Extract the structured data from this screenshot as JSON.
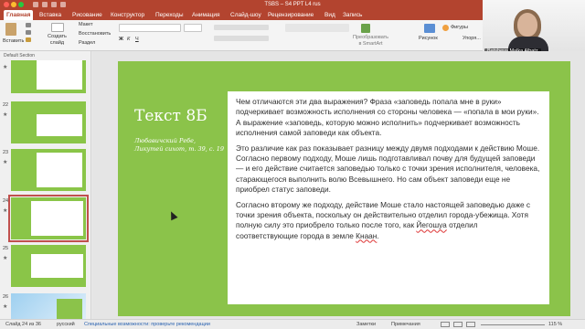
{
  "window": {
    "title": "TSBS – S4 PPT L4 rus"
  },
  "tabs": [
    "Главная",
    "Вставка",
    "Рисование",
    "Конструктор",
    "Переходы",
    "Анимация",
    "Слайд-шоу",
    "Рецензирование",
    "Вид",
    "Запись"
  ],
  "ribbon": {
    "paste": "Вставить",
    "new_slide": "Создать\nслайд",
    "layout": "Макет",
    "reset": "Восстановить",
    "section": "Раздел",
    "convert": "Преобразовать\nв SmartArt",
    "picture": "Рисунок",
    "shapes": "Фигуры",
    "arrange": "Упоря..."
  },
  "webcam": {
    "name": "Batsheva Malka Albatz"
  },
  "leftpanel": {
    "section": "Default Section",
    "slides": [
      {
        "num": "21"
      },
      {
        "num": "22"
      },
      {
        "num": "23"
      },
      {
        "num": "24"
      },
      {
        "num": "25"
      },
      {
        "num": "26"
      }
    ]
  },
  "slide": {
    "title": "Текст 8Б",
    "subtitle": "Любавичский Ребе, Ликутей сихот, т. 39, с. 19",
    "p1": "Чем отличаются эти два выражения? Фраза «заповедь попала мне в руки» подчеркивает возможность исполнения со стороны человека — «попала в мои руки». А выражение «заповедь, которую можно исполнить» подчеркивает возможность исполнения самой заповеди как объекта.",
    "p2": "Это различие как раз показывает разницу между двумя подходами к действию Моше. Согласно первому подходу, Моше лишь подготавливал почву для будущей заповеди — и его действие считается заповедью только с точки зрения исполнителя, человека, старающегося выполнить волю Всевышнего. Но сам объект заповеди еще не приобрел статус заповеди.",
    "p3a": "Согласно второму же подходу, действие Моше стало настоящей заповедью даже с точки зрения объекта, поскольку он действительно отделил города-убежища. Хотя полную силу это приобрело только после того, как ",
    "p3_name1": "Йегошуа",
    "p3b": " отделил соответствующие города в земле ",
    "p3_name2": "Кнаан",
    "p3c": "."
  },
  "statusbar": {
    "slide_info": "Слайд 24 из 36",
    "lang": "русский",
    "accessibility": "Специальные возможности: проверьте рекомендации",
    "notes": "Заметки",
    "comments": "Примечания",
    "zoom": "115 %"
  },
  "colors": {
    "accent": "#b3442f",
    "slide_green": "#8bc34a"
  }
}
